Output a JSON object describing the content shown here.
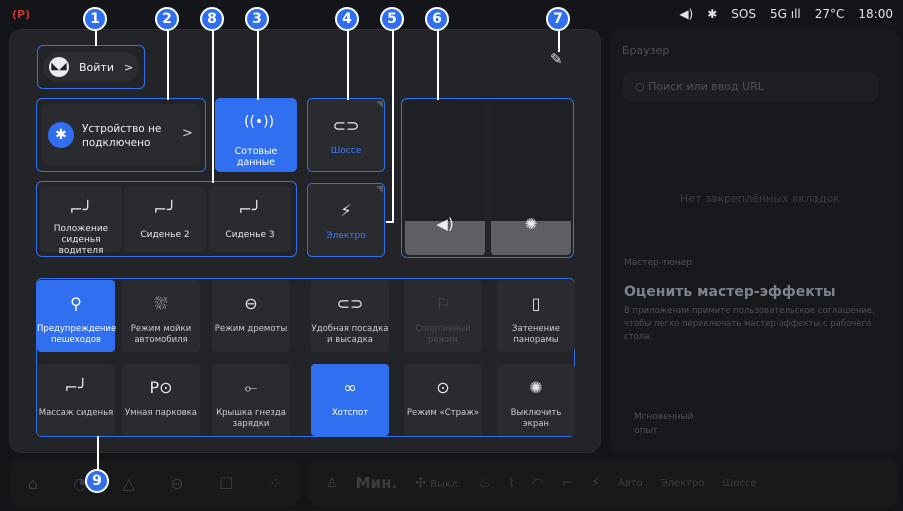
{
  "status_bar": {
    "time": "18:00",
    "temperature": "27°C",
    "network": "5G",
    "sos": "SOS",
    "left_icon": "(P)",
    "volume_icon": "volume-icon",
    "bluetooth_icon": "bluetooth-icon"
  },
  "background_app": {
    "browser_title": "Браузер",
    "search_placeholder": "Поиск или ввод URL",
    "faint_text": "Нет закреплённых вкладок",
    "master_tuner_label": "Мастер-тюнер",
    "master_title": "Оценить мастер-эффекты",
    "master_desc": "В приложении примите пользовательское соглашение, чтобы легко переключать мастер-эффекты с рабочего стола.",
    "instant_label": "Мгновенный опыт"
  },
  "control_center": {
    "login_label": "Войти",
    "login_arrow": ">",
    "bluetooth_status": "Устройство не подключено",
    "bluetooth_arrow": ">",
    "cellular_label": "Сотовые данные",
    "seats": [
      {
        "label": "Положение сиденья водителя"
      },
      {
        "label": "Сиденье 2"
      },
      {
        "label": "Сиденье 3"
      }
    ],
    "drive_mode_label": "Шоссе",
    "energy_mode_label": "Электро",
    "volume_level": 0.22,
    "brightness_level": 0.22,
    "grid_row1": [
      {
        "label": "Предупреждение пешеходов",
        "icon": "pedestrian-icon",
        "active": true
      },
      {
        "label": "Режим мойки автомобиля",
        "icon": "car-wash-icon"
      },
      {
        "label": "Режим дремоты",
        "icon": "nap-seat-icon"
      },
      {
        "label": "Удобная посадка и высадка",
        "icon": "easy-entry-icon"
      },
      {
        "label": "Спортивный режим",
        "icon": "flag-icon",
        "disabled": true
      },
      {
        "label": "Затенение панорамы",
        "icon": "sunroof-icon"
      }
    ],
    "grid_row2": [
      {
        "label": "Массаж сиденья",
        "icon": "massage-seat-icon"
      },
      {
        "label": "Умная парковка",
        "icon": "parking-icon"
      },
      {
        "label": "Крышка гнезда зарядки",
        "icon": "charging-port-icon"
      },
      {
        "label": "Хотспот",
        "icon": "hotspot-link-icon",
        "active": true
      },
      {
        "label": "Режим «Страж»",
        "icon": "sentry-icon"
      },
      {
        "label": "Выключить экран",
        "icon": "screen-off-icon"
      }
    ]
  },
  "callouts": [
    "1",
    "2",
    "3",
    "4",
    "5",
    "6",
    "7",
    "8",
    "9"
  ],
  "dock": {
    "fan_speed": "Мин.",
    "fan_label": "Выкл.",
    "mode_auto": "Авто",
    "mode_electric": "Электро",
    "mode_highway": "Шоссе"
  }
}
